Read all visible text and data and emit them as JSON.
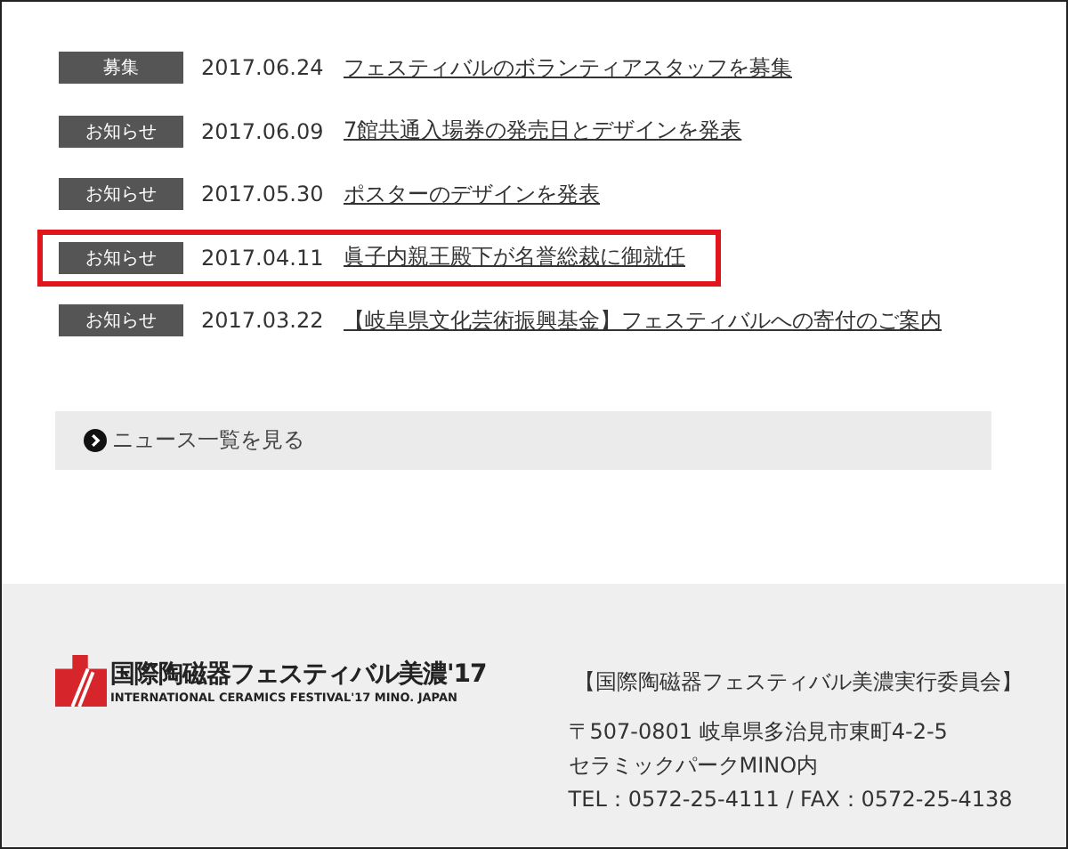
{
  "news": [
    {
      "tag": "募集",
      "date": "2017.06.24",
      "title": "フェスティバルのボランティアスタッフを募集",
      "highlighted": false
    },
    {
      "tag": "お知らせ",
      "date": "2017.06.09",
      "title": "7館共通入場券の発売日とデザインを発表",
      "highlighted": false
    },
    {
      "tag": "お知らせ",
      "date": "2017.05.30",
      "title": "ポスターのデザインを発表",
      "highlighted": false
    },
    {
      "tag": "お知らせ",
      "date": "2017.04.11",
      "title": "眞子内親王殿下が名誉総裁に御就任",
      "highlighted": true
    },
    {
      "tag": "お知らせ",
      "date": "2017.03.22",
      "title": "【岐阜県文化芸術振興基金】フェスティバルへの寄付のご案内",
      "highlighted": false
    }
  ],
  "more_link": "ニュース一覧を見る",
  "footer": {
    "logo_title": "国際陶磁器フェスティバル美濃'17",
    "logo_subtitle": "INTERNATIONAL CERAMICS FESTIVAL'17 MINO. JAPAN",
    "organization": "【国際陶磁器フェスティバル美濃実行委員会】",
    "address_lines": [
      "〒507-0801 岐阜県多治見市東町4-2-5",
      "セラミックパークMINO内",
      "TEL：0572-25-4111 / FAX：0572-25-4138"
    ]
  }
}
